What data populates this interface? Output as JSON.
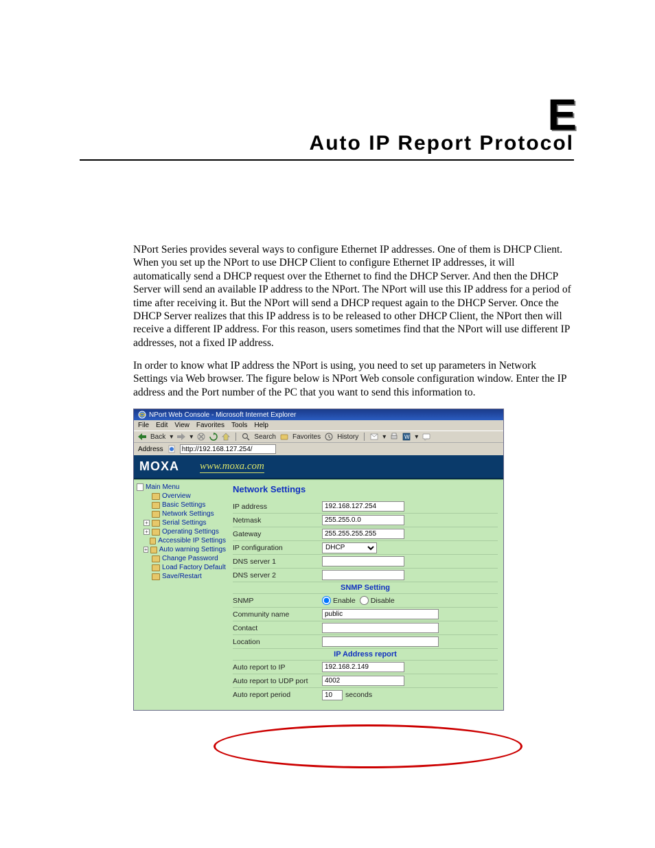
{
  "appendix_letter": "E",
  "doc_title": "Auto IP Report Protocol",
  "para1": "NPort Series provides several ways to configure Ethernet IP addresses. One of them is DHCP Client. When you set up the NPort to use DHCP Client to configure Ethernet IP addresses, it will automatically send a DHCP request over the Ethernet to find the DHCP Server. And then the DHCP Server will send an available IP address to the NPort. The NPort will use this IP address for a period of time after receiving it. But the NPort will send a DHCP request again to the DHCP Server. Once the DHCP Server realizes that this IP address is to be released to other DHCP Client, the NPort then will receive a different IP address. For this reason, users sometimes find that the NPort will use different IP addresses, not a fixed IP address.",
  "para2": "In order to know what IP address the NPort is using, you need to set up parameters in Network Settings via Web browser. The figure below is NPort Web console configuration window. Enter the IP address and the Port number of the PC that you want to send this information to.",
  "ie": {
    "window_title": "NPort Web Console - Microsoft Internet Explorer",
    "menu": [
      "File",
      "Edit",
      "View",
      "Favorites",
      "Tools",
      "Help"
    ],
    "toolbar": {
      "back": "Back",
      "search": "Search",
      "favorites": "Favorites",
      "history": "History"
    },
    "address_label": "Address",
    "address_value": "http://192.168.127.254/"
  },
  "banner": {
    "logo": "MOXA",
    "url": "www.moxa.com"
  },
  "sidebar": {
    "root": "Main Menu",
    "items": [
      {
        "label": "Overview",
        "exp": null
      },
      {
        "label": "Basic Settings",
        "exp": null
      },
      {
        "label": "Network Settings",
        "exp": null
      },
      {
        "label": "Serial Settings",
        "exp": "+"
      },
      {
        "label": "Operating Settings",
        "exp": "+"
      },
      {
        "label": "Accessible IP Settings",
        "exp": null
      },
      {
        "label": "Auto warning Settings",
        "exp": "+"
      },
      {
        "label": "Change Password",
        "exp": null
      },
      {
        "label": "Load Factory Default",
        "exp": null
      },
      {
        "label": "Save/Restart",
        "exp": null
      }
    ]
  },
  "form": {
    "heading": "Network Settings",
    "ip_address": {
      "label": "IP address",
      "value": "192.168.127.254"
    },
    "netmask": {
      "label": "Netmask",
      "value": "255.255.0.0"
    },
    "gateway": {
      "label": "Gateway",
      "value": "255.255.255.255"
    },
    "ip_config": {
      "label": "IP configuration",
      "value": "DHCP"
    },
    "dns1": {
      "label": "DNS server 1",
      "value": ""
    },
    "dns2": {
      "label": "DNS server 2",
      "value": ""
    },
    "snmp_header": "SNMP Setting",
    "snmp": {
      "label": "SNMP",
      "enable": "Enable",
      "disable": "Disable"
    },
    "community": {
      "label": "Community name",
      "value": "public"
    },
    "contact": {
      "label": "Contact",
      "value": ""
    },
    "location": {
      "label": "Location",
      "value": ""
    },
    "ipreport_header": "IP Address report",
    "auto_ip": {
      "label": "Auto report to IP",
      "value": "192.168.2.149"
    },
    "auto_port": {
      "label": "Auto report to UDP port",
      "value": "4002"
    },
    "auto_period": {
      "label": "Auto report period",
      "value": "10",
      "unit": "seconds"
    }
  }
}
